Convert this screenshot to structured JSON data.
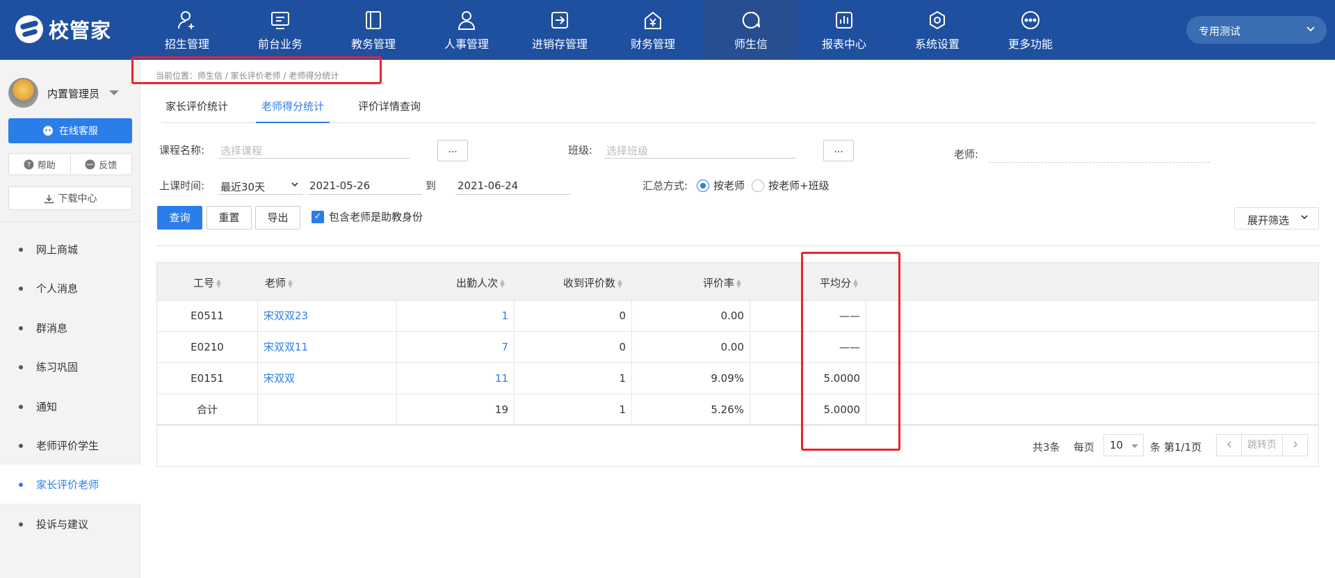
{
  "app": {
    "logo_text": "校管家"
  },
  "nav": [
    {
      "label": "招生管理",
      "icon": "user-plus-icon"
    },
    {
      "label": "前台业务",
      "icon": "monitor-icon"
    },
    {
      "label": "教务管理",
      "icon": "book-icon"
    },
    {
      "label": "人事管理",
      "icon": "person-icon"
    },
    {
      "label": "进销存管理",
      "icon": "enter-box-icon"
    },
    {
      "label": "财务管理",
      "icon": "yen-house-icon"
    },
    {
      "label": "师生信",
      "icon": "chat-bubble-icon",
      "active": true
    },
    {
      "label": "报表中心",
      "icon": "bar-chart-icon"
    },
    {
      "label": "系统设置",
      "icon": "hexagon-gear-icon"
    },
    {
      "label": "更多功能",
      "icon": "more-dots-icon"
    }
  ],
  "top_select": "专用测试",
  "sidebar": {
    "user_name": "内置管理员",
    "online_btn": "在线客服",
    "help": "帮助",
    "feedback": "反馈",
    "download": "下载中心",
    "items": [
      "网上商城",
      "个人消息",
      "群消息",
      "练习巩固",
      "通知",
      "老师评价学生",
      "家长评价老师",
      "投诉与建议"
    ],
    "active_index": 6
  },
  "breadcrumb": "当前位置：师生信 / 家长评价老师 / 老师得分统计",
  "tabs": [
    "家长评价统计",
    "老师得分统计",
    "评价详情查询"
  ],
  "filters": {
    "course_label": "课程名称:",
    "course_placeholder": "选择课程",
    "class_label": "班级:",
    "class_placeholder": "选择班级",
    "teacher_label": "老师:",
    "dots": "...",
    "time_label": "上课时间:",
    "time_range": "最近30天",
    "date_from": "2021-05-26",
    "date_to_label": "到",
    "date_to": "2021-06-24",
    "summary_label": "汇总方式:",
    "radio_teacher": "按老师",
    "radio_teacher_class": "按老师+班级"
  },
  "actions": {
    "query": "查询",
    "reset": "重置",
    "export": "导出",
    "include_assistant": "包含老师是助教身份",
    "expand": "展开筛选"
  },
  "table": {
    "headers": [
      "工号",
      "老师",
      "出勤人次",
      "收到评价数",
      "评价率",
      "平均分"
    ],
    "rows": [
      [
        "E0511",
        "宋双双23",
        "1",
        "0",
        "0.00",
        "——"
      ],
      [
        "E0210",
        "宋双双11",
        "7",
        "0",
        "0.00",
        "——"
      ],
      [
        "E0151",
        "宋双双",
        "11",
        "1",
        "9.09%",
        "5.0000"
      ]
    ],
    "total": [
      "合计",
      "",
      "19",
      "1",
      "5.26%",
      "5.0000"
    ]
  },
  "pagination": {
    "total": "共3条",
    "per_page_label": "每页",
    "per_page": "10",
    "unit": "条",
    "page": "第1/1页",
    "jump": "跳转页"
  },
  "colors": {
    "header_bg": "#1f4f9f",
    "accent": "#2b7de9",
    "highlight": "#e9232d"
  }
}
